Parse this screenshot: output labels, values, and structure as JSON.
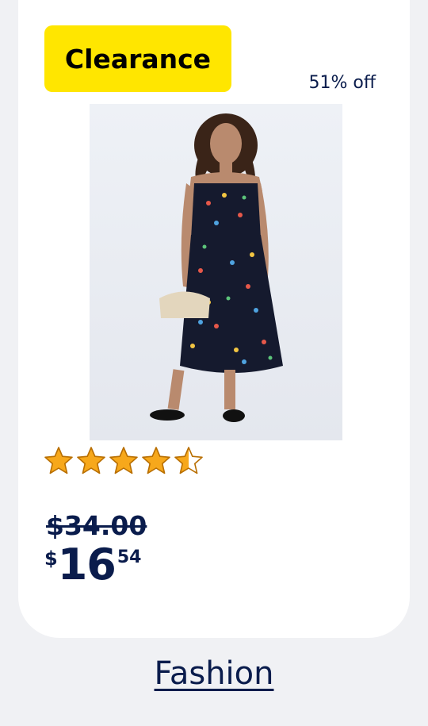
{
  "badge": {
    "label": "Clearance",
    "color": "#ffe600"
  },
  "discount": {
    "text": "51% off"
  },
  "product": {
    "image_icon": "dress-photo",
    "rating": 4.5,
    "rating_max": 5,
    "old_price": "$34.00",
    "price_currency": "$",
    "price_dollars": "16",
    "price_cents": "54"
  },
  "category": {
    "label": "Fashion"
  },
  "colors": {
    "navy": "#0a1c4c",
    "star": "#f7a81b",
    "background": "#f0f1f4"
  }
}
